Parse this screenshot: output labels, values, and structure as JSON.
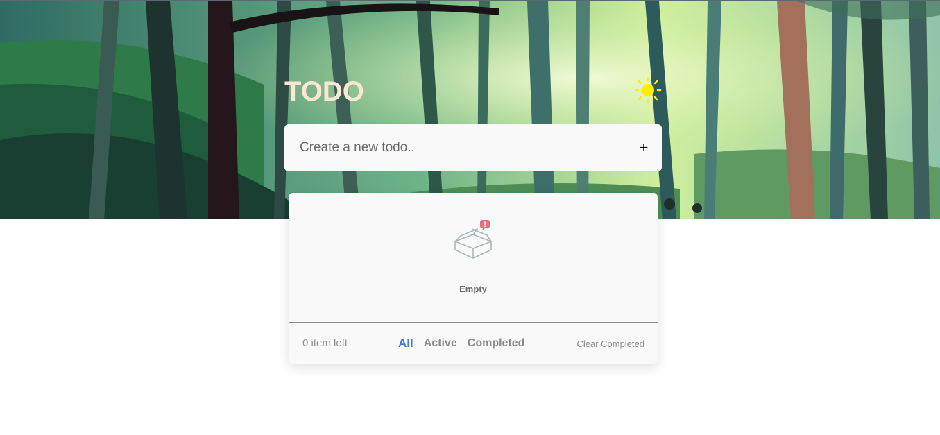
{
  "app": {
    "title": "TODO"
  },
  "theme": {
    "icon": "sun-icon",
    "sun_color": "#ffee00",
    "title_color": "#fbe6d2"
  },
  "new_todo": {
    "placeholder": "Create a new todo..",
    "value": "",
    "add_label": "+"
  },
  "list": {
    "empty_text": "Empty",
    "empty_icon": "empty-box-icon",
    "badge_icon": "alert-badge-icon"
  },
  "footer": {
    "items_left": "0 item left",
    "filters": [
      {
        "label": "All",
        "active": true
      },
      {
        "label": "Active",
        "active": false
      },
      {
        "label": "Completed",
        "active": false
      }
    ],
    "clear_label": "Clear Completed",
    "accent_color": "#3a7bd5"
  }
}
